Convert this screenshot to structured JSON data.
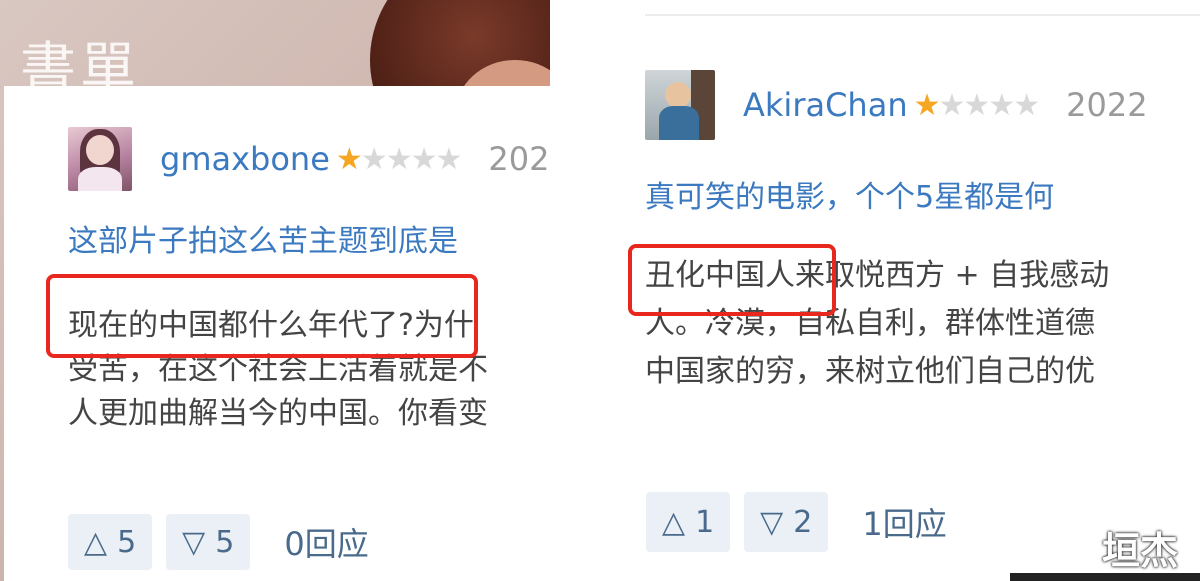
{
  "left_watermark": "書單",
  "right_watermark": "垣杰",
  "review_left": {
    "username": "gmaxbone",
    "rating": 1,
    "rating_max": 5,
    "date": "202",
    "lines": [
      "这部片子拍这么苦主题到底是",
      "现在的中国都什么年代了?为什",
      "受苦，在这个社会上活着就是不",
      "人更加曲解当今的中国。你看变"
    ],
    "highlight": "现在的中国都什么年代了?",
    "upvotes": "5",
    "downvotes": "5",
    "replies": "0回应"
  },
  "review_right": {
    "username": "AkiraChan",
    "rating": 1,
    "rating_max": 5,
    "date": "2022",
    "lines": [
      "真可笑的电影，个个5星都是何",
      "丑化中国人来取悦西方 + 自我感动",
      "人。冷漠，自私自利，群体性道德",
      "中国家的穷，来树立他们自己的优"
    ],
    "highlight": "丑化中国人",
    "upvotes": "1",
    "downvotes": "2",
    "replies": "1回应"
  },
  "colors": {
    "username": "#3b79c0",
    "star_on": "#f5a623",
    "highlight_box": "#e8281e"
  }
}
